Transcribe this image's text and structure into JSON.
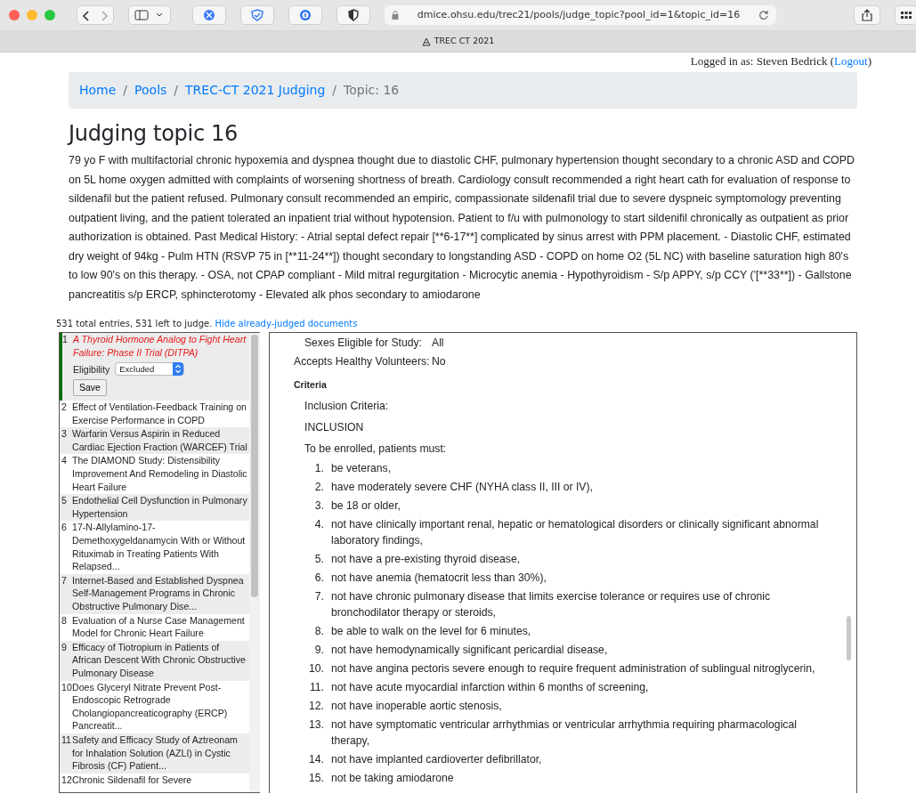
{
  "browser": {
    "url": "dmice.ohsu.edu/trec21/pools/judge_topic?pool_id=1&topic_id=16",
    "tab_title": "TREC CT 2021"
  },
  "login": {
    "text": "Logged in as: Steven Bedrick (",
    "link": "Logout",
    "suffix": ")"
  },
  "breadcrumb": {
    "divider": "/",
    "items": [
      {
        "label": "Home",
        "active": false
      },
      {
        "label": "Pools",
        "active": false
      },
      {
        "label": "TREC-CT 2021 Judging",
        "active": false
      },
      {
        "label": "Topic: 16",
        "active": true
      }
    ]
  },
  "heading": "Judging topic 16",
  "description": "79 yo F with multifactorial chronic hypoxemia and dyspnea thought due to diastolic CHF, pulmonary hypertension thought secondary to a chronic ASD and COPD on 5L home oxygen admitted with complaints of worsening shortness of breath. Cardiology consult recommended a right heart cath for evaluation of response to sildenafil but the patient refused. Pulmonary consult recommended an empiric, compassionate sildenafil trial due to severe dyspneic symptomology preventing outpatient living, and the patient tolerated an inpatient trial without hypotension. Patient to f/u with pulmonology to start sildenifil chronically as outpatient as prior authorization is obtained. Past Medical History: - Atrial septal defect repair [**6-17**] complicated by sinus arrest with PPM placement. - Diastolic CHF, estimated dry weight of 94kg - Pulm HTN (RSVP 75 in [**11-24**]) thought secondary to longstanding ASD - COPD on home O2 (5L NC) with baseline saturation high 80's to low 90's on this therapy. - OSA, not CPAP compliant - Mild mitral regurgitation - Microcytic anemia - Hypothyroidism - S/p APPY, s/p CCY ('[**33**]) - Gallstone pancreatitis s/p ERCP, sphincterotomy - Elevated alk phos secondary to amiodarone",
  "counts": {
    "text": "531 total entries, 531 left to judge.",
    "link": "Hide already-judged documents"
  },
  "judging": {
    "label": "Eligibility",
    "value": "Excluded",
    "button": "Save"
  },
  "documents": [
    {
      "num": "1",
      "title": "A Thyroid Hormone Analog to Fight Heart Failure: Phase II Trial (DITPA)",
      "selected": true
    },
    {
      "num": "2",
      "title": "Effect of Ventilation-Feedback Training on Exercise Performance in COPD",
      "selected": false
    },
    {
      "num": "3",
      "title": "Warfarin Versus Aspirin in Reduced Cardiac Ejection Fraction (WARCEF) Trial",
      "selected": false
    },
    {
      "num": "4",
      "title": "The DIAMOND Study: Distensibility Improvement And Remodeling in Diastolic Heart Failure",
      "selected": false
    },
    {
      "num": "5",
      "title": "Endothelial Cell Dysfunction in Pulmonary Hypertension",
      "selected": false
    },
    {
      "num": "6",
      "title": "17-N-Allylamino-17-Demethoxygeldanamycin With or Without Rituximab in Treating Patients With Relapsed...",
      "selected": false
    },
    {
      "num": "7",
      "title": "Internet-Based and Established Dyspnea Self-Management Programs in Chronic Obstructive Pulmonary Dise...",
      "selected": false
    },
    {
      "num": "8",
      "title": "Evaluation of a Nurse Case Management Model for Chronic Heart Failure",
      "selected": false
    },
    {
      "num": "9",
      "title": "Efficacy of Tiotropium in Patients of African Descent With Chronic Obstructive Pulmonary Disease",
      "selected": false
    },
    {
      "num": "10",
      "title": "Does Glyceryl Nitrate Prevent Post-Endoscopic Retrograde Cholangiopancreaticography (ERCP) Pancreatit...",
      "selected": false
    },
    {
      "num": "11",
      "title": "Safety and Efficacy Study of Aztreonam for Inhalation Solution (AZLI) in Cystic Fibrosis (CF) Patient...",
      "selected": false
    },
    {
      "num": "12",
      "title": "Chronic Sildenafil for Severe",
      "selected": false
    }
  ],
  "detail": {
    "fields": [
      {
        "label": "Sexes Eligible for Study:",
        "value": "All"
      },
      {
        "label": "Accepts Healthy Volunteers:",
        "value": "No"
      }
    ],
    "section": "Criteria",
    "paragraphs": [
      "Inclusion Criteria:",
      "INCLUSION",
      "To be enrolled, patients must:"
    ],
    "criteria": [
      {
        "num": "1.",
        "text": "be veterans,"
      },
      {
        "num": "2.",
        "text": "have moderately severe CHF (NYHA class II, III or IV),"
      },
      {
        "num": "3.",
        "text": "be 18 or older,"
      },
      {
        "num": "4.",
        "text": "not have clinically important renal, hepatic or hematological disorders or clinically significant abnormal laboratory findings,"
      },
      {
        "num": "5.",
        "text": "not have a pre-existing thyroid disease,"
      },
      {
        "num": "6.",
        "text": "not have anemia (hematocrit less than 30%),"
      },
      {
        "num": "7.",
        "text": "not have chronic pulmonary disease that limits exercise tolerance or requires use of chronic bronchodilator therapy or steroids,"
      },
      {
        "num": "8.",
        "text": "be able to walk on the level for 6 minutes,"
      },
      {
        "num": "9.",
        "text": "not have hemodynamically significant pericardial disease,"
      },
      {
        "num": "10.",
        "text": "not have angina pectoris severe enough to require frequent administration of sublingual nitroglycerin,"
      },
      {
        "num": "11.",
        "text": "not have acute myocardial infarction within 6 months of screening,"
      },
      {
        "num": "12.",
        "text": "not have inoperable aortic stenosis,"
      },
      {
        "num": "13.",
        "text": "not have symptomatic ventricular arrhythmias or ventricular arrhythmia requiring pharmacological therapy,"
      },
      {
        "num": "14.",
        "text": "not have implanted cardioverter defibrillator,"
      },
      {
        "num": "15.",
        "text": "not be taking amiodarone"
      }
    ]
  }
}
